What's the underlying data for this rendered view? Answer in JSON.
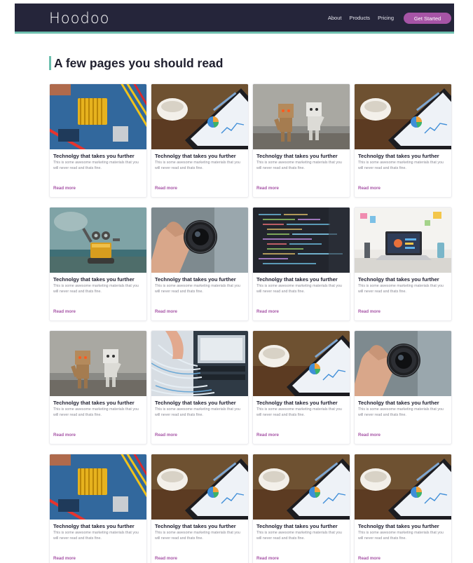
{
  "brand": {
    "logo": "Hoodoo",
    "accent": "#6dbfae",
    "primary": "#a654a6",
    "navbar_bg": "#25253a"
  },
  "nav": {
    "links": [
      "About",
      "Products",
      "Pricing"
    ],
    "cta": "Get Started"
  },
  "section": {
    "title": "A few pages you should read"
  },
  "cards": [
    {
      "image": "motherboard",
      "title": "Technolgy that takes you further",
      "text": "This is some awesome marketing materials that you will never read and thats fine.",
      "link": "Read more"
    },
    {
      "image": "tablet-analytics",
      "title": "Technolgy that takes you further",
      "text": "This is some awesome marketing materials that you will never read and thats fine.",
      "link": "Read more"
    },
    {
      "image": "cardboard-robots",
      "title": "Technolgy that takes you further",
      "text": "This is some awesome marketing materials that you will never read and thats fine.",
      "link": "Read more"
    },
    {
      "image": "tablet-analytics",
      "title": "Technolgy that takes you further",
      "text": "This is some awesome marketing materials that you will never read and thats fine.",
      "link": "Read more"
    },
    {
      "image": "toy-robot",
      "title": "Technolgy that takes you further",
      "text": "This is some awesome marketing materials that you will never read and thats fine.",
      "link": "Read more"
    },
    {
      "image": "camera-lens",
      "title": "Technolgy that takes you further",
      "text": "This is some awesome marketing materials that you will never read and thats fine.",
      "link": "Read more"
    },
    {
      "image": "code-screen",
      "title": "Technolgy that takes you further",
      "text": "This is some awesome marketing materials that you will never read and thats fine.",
      "link": "Read more"
    },
    {
      "image": "laptop-desk",
      "title": "Technolgy that takes you further",
      "text": "This is some awesome marketing materials that you will never read and thats fine.",
      "link": "Read more"
    },
    {
      "image": "cardboard-robots",
      "title": "Technolgy that takes you further",
      "text": "This is some awesome marketing materials that you will never read and thats fine.",
      "link": "Read more"
    },
    {
      "image": "server-cables",
      "title": "Technolgy that takes you further",
      "text": "This is some awesome marketing materials that you will never read and thats fine.",
      "link": "Read more"
    },
    {
      "image": "tablet-analytics",
      "title": "Technolgy that takes you further",
      "text": "This is some awesome marketing materials that you will never read and thats fine.",
      "link": "Read more"
    },
    {
      "image": "camera-lens",
      "title": "Technolgy that takes you further",
      "text": "This is some awesome marketing materials that you will never read and thats fine.",
      "link": "Read more"
    },
    {
      "image": "motherboard",
      "title": "Technolgy that takes you further",
      "text": "This is some awesome marketing materials that you will never read and thats fine.",
      "link": "Read more"
    },
    {
      "image": "tablet-analytics",
      "title": "Technolgy that takes you further",
      "text": "This is some awesome marketing materials that you will never read and thats fine.",
      "link": "Read more"
    },
    {
      "image": "tablet-analytics",
      "title": "Technolgy that takes you further",
      "text": "This is some awesome marketing materials that you will never read and thats fine.",
      "link": "Read more"
    },
    {
      "image": "tablet-analytics",
      "title": "Technolgy that takes you further",
      "text": "This is some awesome marketing materials that you will never read and thats fine.",
      "link": "Read more"
    }
  ]
}
